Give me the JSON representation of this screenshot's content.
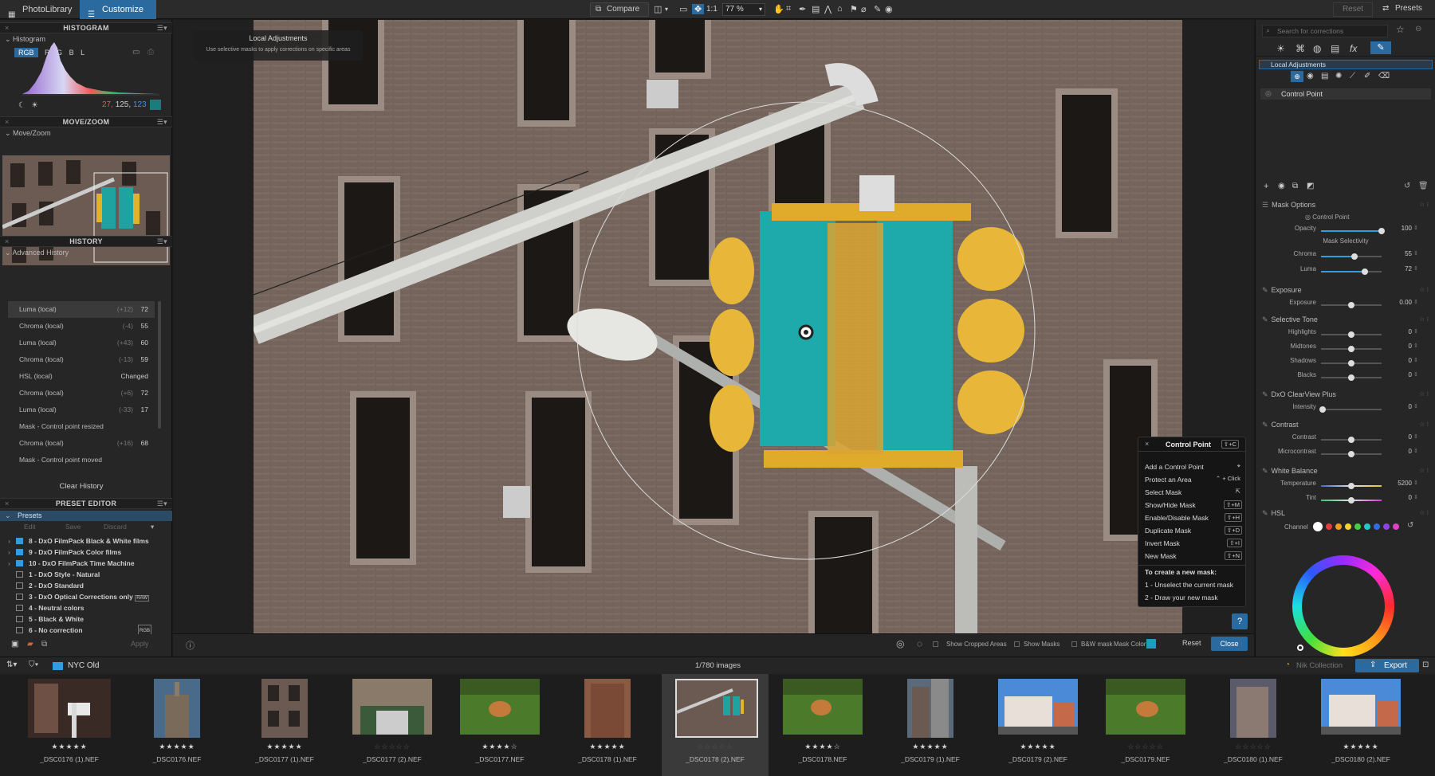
{
  "topbar": {
    "tabs": [
      {
        "label": "PhotoLibrary"
      },
      {
        "label": "Customize"
      }
    ],
    "compare_label": "Compare",
    "ratio_label": "1:1",
    "zoom_value": "77 %",
    "reset_label": "Reset",
    "presets_label": "Presets"
  },
  "histogram": {
    "header": "HISTOGRAM",
    "title": "Histogram",
    "channels": [
      "RGB",
      "R",
      "G",
      "B",
      "L"
    ],
    "selected_channel": "RGB",
    "values": {
      "r": "27,",
      "g": "125,",
      "b": "123"
    },
    "swatch_color": "#1b7d7b"
  },
  "movezoom": {
    "header": "MOVE/ZOOM",
    "title": "Move/Zoom"
  },
  "history": {
    "header": "HISTORY",
    "title": "Advanced History",
    "items": [
      {
        "label": "Luma (local)",
        "delta": "(+12)",
        "value": "72"
      },
      {
        "label": "Chroma (local)",
        "delta": "(-4)",
        "value": "55"
      },
      {
        "label": "Luma (local)",
        "delta": "(+43)",
        "value": "60"
      },
      {
        "label": "Chroma (local)",
        "delta": "(-13)",
        "value": "59"
      },
      {
        "label": "HSL (local)",
        "delta": "",
        "value": "Changed"
      },
      {
        "label": "Chroma (local)",
        "delta": "(+6)",
        "value": "72"
      },
      {
        "label": "Luma (local)",
        "delta": "(-33)",
        "value": "17"
      },
      {
        "label": "Mask - Control point resized",
        "delta": "",
        "value": ""
      },
      {
        "label": "Chroma (local)",
        "delta": "(+16)",
        "value": "68"
      },
      {
        "label": "Mask - Control point moved",
        "delta": "",
        "value": ""
      }
    ],
    "clear_label": "Clear History"
  },
  "preset_editor": {
    "header": "PRESET EDITOR",
    "title": "Presets",
    "edit_label": "Edit",
    "save_label": "Save",
    "discard_label": "Discard",
    "apply_label": "Apply",
    "items": [
      {
        "label": "8 - DxO FilmPack Black & White films",
        "folder": true,
        "expander": true
      },
      {
        "label": "9 - DxO FilmPack Color films",
        "folder": true,
        "expander": true
      },
      {
        "label": "10 - DxO FilmPack Time Machine",
        "folder": true,
        "expander": true
      },
      {
        "label": "1 - DxO Style - Natural",
        "folder": false,
        "expander": false
      },
      {
        "label": "2 - DxO Standard",
        "folder": false,
        "expander": false
      },
      {
        "label": "3 - DxO Optical Corrections only",
        "folder": false,
        "expander": false,
        "badge": "RAW"
      },
      {
        "label": "4 - Neutral colors",
        "folder": false,
        "expander": false
      },
      {
        "label": "5 - Black & White",
        "folder": false,
        "expander": false
      },
      {
        "label": "6 - No correction",
        "folder": false,
        "expander": false,
        "badge": "RGB"
      }
    ]
  },
  "viewer": {
    "tooltip_title": "Local Adjustments",
    "tooltip_text": "Use selective masks to apply corrections on specific areas",
    "footer": {
      "show_cropped": "Show Cropped Areas",
      "show_masks": "Show Masks",
      "bw_mask": "B&W mask",
      "mask_color_label": "Mask Color",
      "mask_color": "#1a9fbd",
      "reset_label": "Reset",
      "close_label": "Close"
    }
  },
  "control_point_popup": {
    "title": "Control Point",
    "title_shortcut": "⇧+C",
    "rows": [
      {
        "label": "Add a Control Point",
        "shortcut": "⌖"
      },
      {
        "label": "Protect an Area",
        "shortcut": "⌃ + Click"
      },
      {
        "label": "Select Mask",
        "shortcut": "⇱"
      },
      {
        "label": "Show/Hide Mask",
        "shortcut": "⇧+M"
      },
      {
        "label": "Enable/Disable Mask",
        "shortcut": "⇧+H"
      },
      {
        "label": "Duplicate Mask",
        "shortcut": "⇧+D"
      },
      {
        "label": "Invert Mask",
        "shortcut": "⇧+I"
      },
      {
        "label": "New Mask",
        "shortcut": "⇧+N"
      }
    ],
    "howto_title": "To create a new mask:",
    "howto_step1": "1 - Unselect the current mask",
    "howto_step2": "2 - Draw your new mask",
    "help_label": "?"
  },
  "right_panel": {
    "search_placeholder": "Search for corrections",
    "local_adjustments_label": "Local Adjustments",
    "control_point_label": "Control Point",
    "mask_options": {
      "title": "Mask Options",
      "type_label": "Control Point",
      "opacity": {
        "label": "Opacity",
        "value": "100",
        "fraction": 1.0
      },
      "selectivity_title": "Mask Selectivity",
      "chroma": {
        "label": "Chroma",
        "value": "55",
        "fraction": 0.55
      },
      "luma": {
        "label": "Luma",
        "value": "72",
        "fraction": 0.72
      }
    },
    "exposure": {
      "title": "Exposure",
      "rows": [
        {
          "label": "Exposure",
          "value": "0.00",
          "fraction": 0.5
        }
      ]
    },
    "selective_tone": {
      "title": "Selective Tone",
      "rows": [
        {
          "label": "Highlights",
          "value": "0",
          "fraction": 0.5
        },
        {
          "label": "Midtones",
          "value": "0",
          "fraction": 0.5
        },
        {
          "label": "Shadows",
          "value": "0",
          "fraction": 0.5
        },
        {
          "label": "Blacks",
          "value": "0",
          "fraction": 0.5
        }
      ]
    },
    "clearview": {
      "title": "DxO ClearView Plus",
      "rows": [
        {
          "label": "Intensity",
          "value": "0",
          "fraction": 0.0
        }
      ]
    },
    "contrast": {
      "title": "Contrast",
      "rows": [
        {
          "label": "Contrast",
          "value": "0",
          "fraction": 0.5
        },
        {
          "label": "Microcontrast",
          "value": "0",
          "fraction": 0.5
        }
      ]
    },
    "white_balance": {
      "title": "White Balance",
      "rows": [
        {
          "label": "Temperature",
          "value": "5200",
          "fraction": 0.5
        },
        {
          "label": "Tint",
          "value": "0",
          "fraction": 0.5
        }
      ]
    },
    "hsl": {
      "title": "HSL",
      "channel_label": "Channel",
      "channel_colors": [
        "#ffffff",
        "#e83a3a",
        "#f39c1f",
        "#f3d22a",
        "#3fd13f",
        "#22c9c9",
        "#2f6ee0",
        "#8b44e0",
        "#e040c8"
      ]
    }
  },
  "filmstrip": {
    "folder_name": "NYC Old",
    "image_count": "1/780 images",
    "nik_label": "Nik Collection",
    "export_label": "Export",
    "items": [
      {
        "name": "_DSC0176 (1).NEF",
        "stars": "★★★★★",
        "selected": false
      },
      {
        "name": "_DSC0176.NEF",
        "stars": "★★★★★",
        "selected": false
      },
      {
        "name": "_DSC0177 (1).NEF",
        "stars": "★★★★★",
        "selected": false
      },
      {
        "name": "_DSC0177 (2).NEF",
        "stars": "☆☆☆☆☆",
        "selected": false
      },
      {
        "name": "_DSC0177.NEF",
        "stars": "★★★★☆",
        "selected": false
      },
      {
        "name": "_DSC0178 (1).NEF",
        "stars": "★★★★★",
        "selected": false
      },
      {
        "name": "_DSC0178 (2).NEF",
        "stars": "☆☆☆☆☆",
        "selected": true
      },
      {
        "name": "_DSC0178.NEF",
        "stars": "★★★★☆",
        "selected": false
      },
      {
        "name": "_DSC0179 (1).NEF",
        "stars": "★★★★★",
        "selected": false
      },
      {
        "name": "_DSC0179 (2).NEF",
        "stars": "★★★★★",
        "selected": false
      },
      {
        "name": "_DSC0179.NEF",
        "stars": "☆☆☆☆☆",
        "selected": false
      },
      {
        "name": "_DSC0180 (1).NEF",
        "stars": "☆☆☆☆☆",
        "selected": false
      },
      {
        "name": "_DSC0180 (2).NEF",
        "stars": "★★★★★",
        "selected": false
      }
    ]
  }
}
